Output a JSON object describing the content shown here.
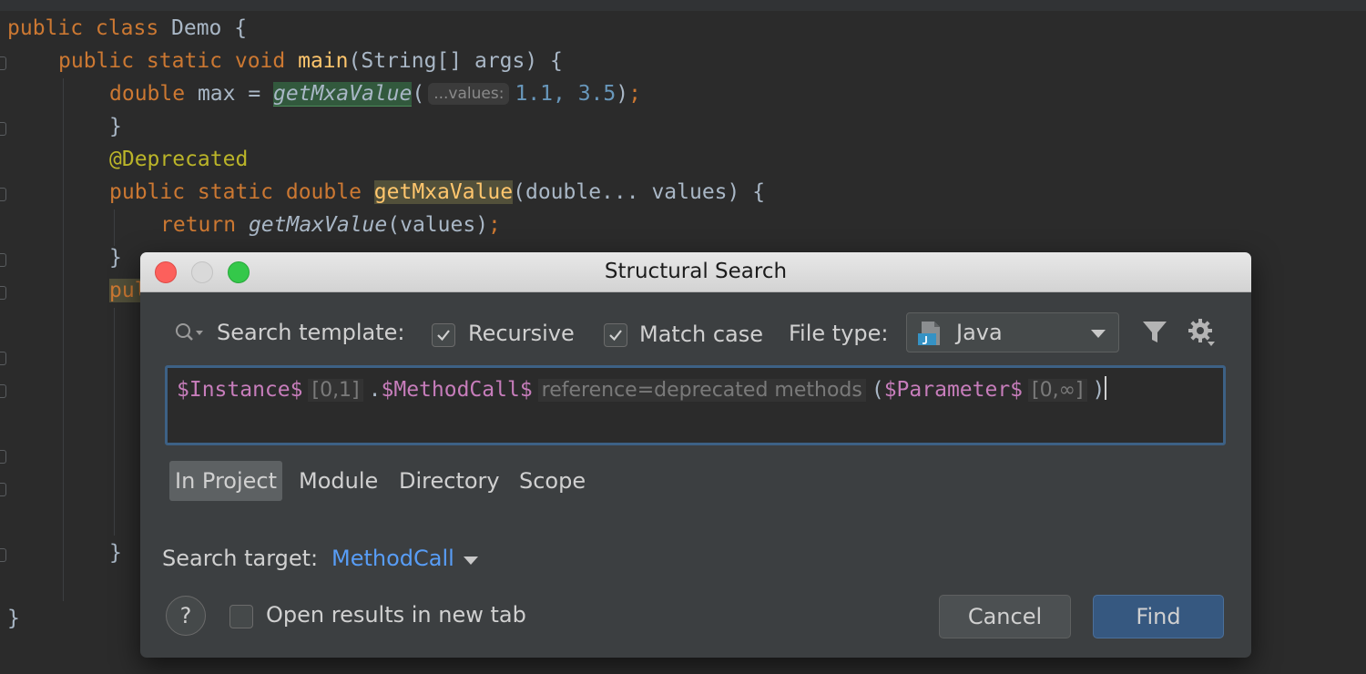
{
  "editor": {
    "lines": [
      {
        "parts": [
          [
            "kw",
            "public class "
          ],
          [
            "cls",
            "Demo {"
          ]
        ]
      },
      {
        "parts": [
          [
            "kw",
            "public static void "
          ],
          [
            "fn",
            "main"
          ],
          [
            "cls",
            "(String[] args) {"
          ]
        ]
      },
      {
        "parts": [
          [
            "kw",
            "double "
          ],
          [
            "cls",
            "max = "
          ]
        ]
      },
      {
        "parts": [
          [
            "cls",
            "}"
          ]
        ]
      },
      {
        "parts": [
          [
            "ann",
            "@Deprecated"
          ]
        ]
      },
      {
        "parts": [
          [
            "kw",
            "public static double "
          ]
        ]
      },
      {
        "parts": [
          [
            "kw",
            "return "
          ],
          [
            "it",
            "getMaxValue"
          ],
          [
            "cls",
            "(values)"
          ],
          [
            "kw",
            ";"
          ]
        ]
      },
      {
        "parts": [
          [
            "cls",
            "}"
          ]
        ]
      },
      {
        "parts": [
          [
            "kw",
            "pul"
          ]
        ]
      },
      {
        "parts": [
          [
            "cls",
            "}"
          ]
        ]
      },
      {
        "parts": [
          [
            "cls",
            "}"
          ]
        ]
      }
    ],
    "call_name": "getMxaValue",
    "hint": "...values:",
    "call_args": "1.1, 3.5",
    "decl_name": "getMxaValue",
    "decl_params": "(double... values) {"
  },
  "dialog": {
    "title": "Structural Search",
    "search_template_label": "Search template:",
    "recursive_label": "Recursive",
    "recursive_checked": true,
    "match_case_label": "Match case",
    "match_case_checked": true,
    "file_type_label": "File type:",
    "file_type_value": "Java",
    "template": {
      "instance_var": "$Instance$",
      "instance_count": "[0,1]",
      "dot": ".",
      "method_var": "$MethodCall$",
      "method_constraint": "reference=deprecated methods",
      "open_paren": "(",
      "param_var": "$Parameter$",
      "param_count": "[0,∞]",
      "close_paren": ")"
    },
    "scopes": [
      "In Project",
      "Module",
      "Directory",
      "Scope"
    ],
    "active_scope": "In Project",
    "search_target_label": "Search target:",
    "search_target_value": "MethodCall",
    "help_label": "?",
    "open_in_new_tab_label": "Open results in new tab",
    "open_in_new_tab_checked": false,
    "cancel_label": "Cancel",
    "find_label": "Find"
  },
  "colors": {
    "editor_bg": "#2b2b2b",
    "dialog_bg": "#3c3f41",
    "keyword": "#cc7832",
    "function": "#ffc66d",
    "number": "#6897bb",
    "annotation": "#bbb529",
    "template_var": "#c77dbb",
    "link": "#589df6",
    "find_button": "#365880"
  }
}
